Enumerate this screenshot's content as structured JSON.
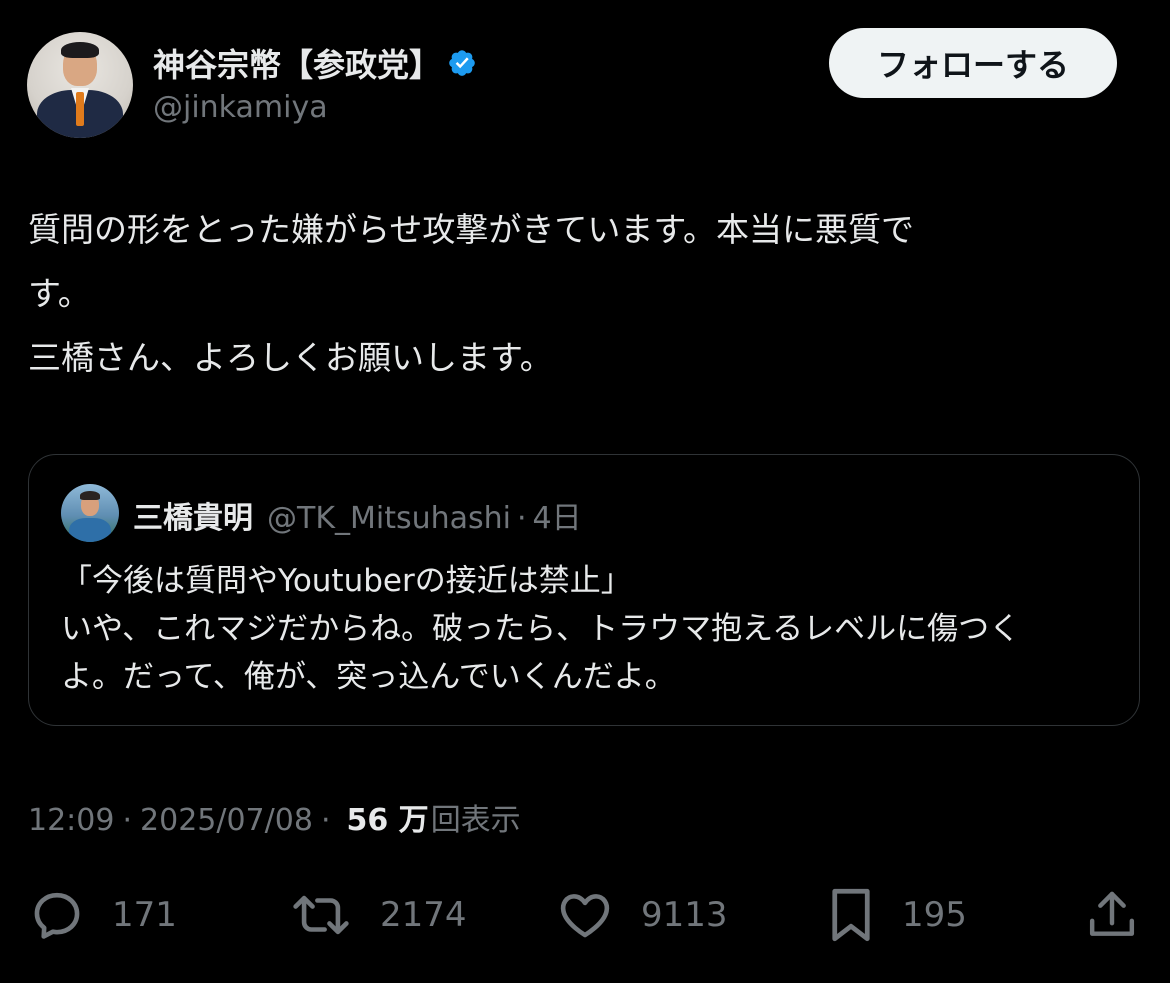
{
  "author": {
    "display_name": "神谷宗幣【参政党】",
    "handle": "@jinkamiya",
    "verified": true,
    "verified_color": "#1d9bf0"
  },
  "follow_button": {
    "label": "フォローする"
  },
  "tweet": {
    "lines": [
      "質問の形をとった嫌がらせ攻撃がきています。本当に悪質で",
      "す。",
      "三橋さん、よろしくお願いします。"
    ]
  },
  "quote": {
    "display_name": "三橋貴明",
    "handle": "@TK_Mitsuhashi",
    "separator": "·",
    "time": "4日",
    "lines": [
      "「今後は質問やYoutuberの接近は禁止」",
      "いや、これマジだからね。破ったら、トラウマ抱えるレベルに傷つく",
      "よ。だって、俺が、突っ込んでいくんだよ。"
    ]
  },
  "meta": {
    "time": "12:09",
    "date": "2025/07/08",
    "separator": "·",
    "views_count": "56 万",
    "views_label": "回表示"
  },
  "actions": {
    "reply": {
      "icon": "reply-icon",
      "count": "171"
    },
    "repost": {
      "icon": "repost-icon",
      "count": "2174"
    },
    "like": {
      "icon": "heart-icon",
      "count": "9113"
    },
    "bookmark": {
      "icon": "bookmark-icon",
      "count": "195"
    },
    "share": {
      "icon": "share-icon"
    }
  },
  "colors": {
    "background": "#000000",
    "text_primary": "#e7e9ea",
    "text_secondary": "#71767b",
    "border": "#2f3336",
    "follow_bg": "#eff3f4"
  }
}
